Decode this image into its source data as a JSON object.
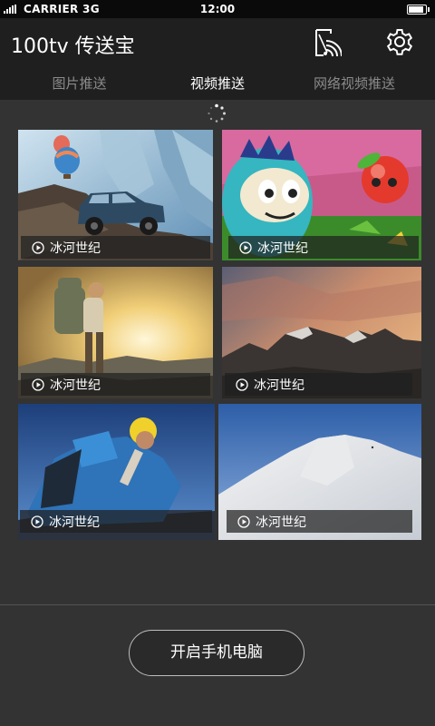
{
  "status_bar": {
    "carrier": "CARRIER 3G",
    "time": "12:00"
  },
  "app": {
    "title": "100tv 传送宝"
  },
  "tabs": [
    {
      "label": "图片推送",
      "active": false
    },
    {
      "label": "视频推送",
      "active": true
    },
    {
      "label": "网络视频推送",
      "active": false
    }
  ],
  "videos": [
    {
      "title": "冰河世纪",
      "scene": "truck-balloons-icebergs"
    },
    {
      "title": "冰河世纪",
      "scene": "cartoon-monster-apple"
    },
    {
      "title": "冰河世纪",
      "scene": "hiker-sunset"
    },
    {
      "title": "冰河世纪",
      "scene": "mountain-peaks-dusk"
    },
    {
      "title": "冰河世纪",
      "scene": "climber-blue-sky"
    },
    {
      "title": "冰河世纪",
      "scene": "snow-slope"
    }
  ],
  "start_button": {
    "label": "开启手机电脑"
  },
  "colors": {
    "background": "#333333",
    "appbar": "#1f1f1f",
    "active_tab": "#ffffff",
    "inactive_tab": "#8b8b8b"
  }
}
